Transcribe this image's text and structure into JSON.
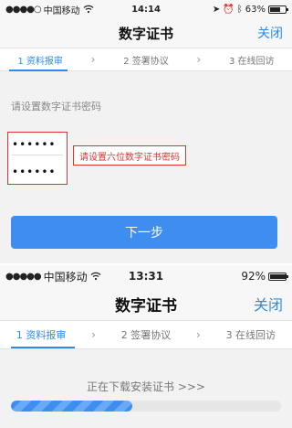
{
  "screen1": {
    "status": {
      "carrier": "中国移动",
      "time": "14:14",
      "battery": "63%"
    },
    "title": "数字证书",
    "close_label": "关闭",
    "steps": [
      {
        "label": "1 资料报审",
        "active": true
      },
      {
        "label": "2 签署协议",
        "active": false
      },
      {
        "label": "3 在线回访",
        "active": false
      }
    ],
    "hint": "请设置数字证书密码",
    "password_mask_1": "••••••",
    "password_mask_2": "••••••",
    "annotation": "请设置六位数字证书密码",
    "next_label": "下一步"
  },
  "screen2": {
    "status": {
      "carrier": "中国移动",
      "time": "13:31",
      "battery": "92%"
    },
    "title": "数字证书",
    "close_label": "关闭",
    "steps": [
      {
        "label": "1 资料报审",
        "active": true
      },
      {
        "label": "2 签署协议",
        "active": false
      },
      {
        "label": "3 在线回访",
        "active": false
      }
    ],
    "downloading_text": "正在下载安装证书 >>>",
    "download_progress": 0.45
  },
  "colors": {
    "accent": "#2a8cf0",
    "button": "#3e8ef0",
    "annotation": "#d33333"
  },
  "icons": [
    "signal-dots-icon",
    "wifi-icon",
    "location-icon",
    "alarm-icon",
    "bluetooth-icon",
    "battery-icon",
    "chevron-right-icon"
  ]
}
